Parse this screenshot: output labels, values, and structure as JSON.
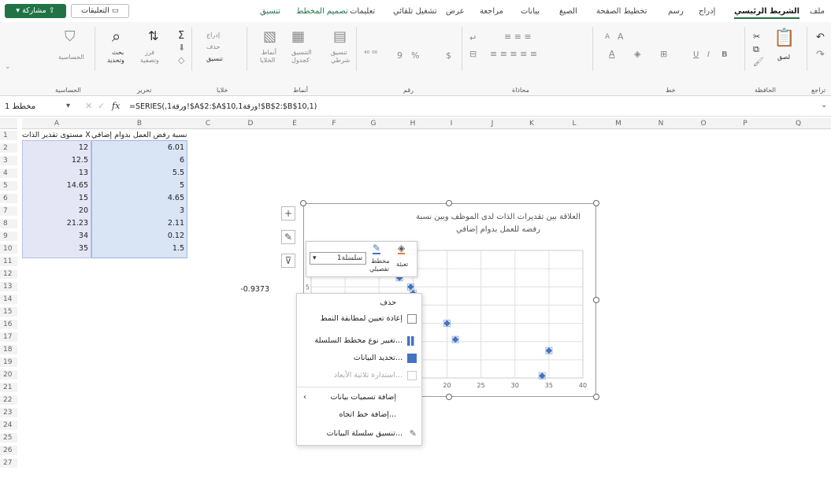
{
  "tabs": {
    "file": "ملف",
    "home": "الشريط الرئيسي",
    "insert": "إدراج",
    "draw": "رسم",
    "page_layout": "تخطيط الصفحة",
    "formulas": "الصيغ",
    "data": "بيانات",
    "review": "مراجعة",
    "view": "عرض",
    "automate": "تشغيل تلقائي",
    "help": "تعليمات",
    "chart_design": "تصميم المخطط",
    "format": "تنسيق"
  },
  "header_buttons": {
    "comments": "التعليقات",
    "share": "مشاركة"
  },
  "ribbon_groups": {
    "undo": "تراجع",
    "clipboard": "الحافظة",
    "font": "خط",
    "alignment": "محاذاة",
    "number": "رقم",
    "styles": "أنماط",
    "cells": "خلايا",
    "editing": "تحرير",
    "sensitivity": "الحساسية"
  },
  "ribbon_items": {
    "paste": "لصق",
    "find": "بحث",
    "find2": "وتحديد",
    "sort": "فرز",
    "filter": "وتصفية",
    "format_cells": "تنسيق",
    "insert_cells": "إدراج",
    "delete_cells": "حذف",
    "cond_format": "تنسيق",
    "cond_format2": "شرطي",
    "format_table": "التنسيق",
    "format_table2": "كجدول",
    "cell_styles": "أنماط",
    "cell_styles2": "الخلايا",
    "sensitivity": "الحساسية",
    "currency": "$",
    "percent": "%",
    "comma": "9",
    "font_size_up": "A",
    "font_size_down": "A",
    "bold": "B",
    "italic": "I",
    "underline": "U"
  },
  "formula_bar": {
    "name_box": "مخطط 1",
    "fx": "fx",
    "formula": "=SERIES(,ورقة1!$A$2:$A$10,ورقة1!$B$2:$B$10,1)"
  },
  "columns": [
    "A",
    "B",
    "C",
    "D",
    "E",
    "F",
    "G",
    "H",
    "I",
    "J",
    "K",
    "L",
    "M",
    "N",
    "O",
    "P",
    "Q"
  ],
  "rows": [
    "1",
    "2",
    "3",
    "4",
    "5",
    "6",
    "7",
    "8",
    "9",
    "10",
    "11",
    "12",
    "13",
    "14",
    "15",
    "16",
    "17",
    "18",
    "19",
    "20",
    "21",
    "22",
    "23",
    "24",
    "25",
    "26",
    "27"
  ],
  "sheet": {
    "header_a": "مستوى تقدير الذات X",
    "header_b": "نسبة رفض العمل بدوام إضافي Y",
    "col_a": [
      "12",
      "12.5",
      "13",
      "14.65",
      "15",
      "20",
      "21.23",
      "34",
      "35"
    ],
    "col_b": [
      "6.01",
      "6",
      "5.5",
      "5",
      "4.65",
      "3",
      "2.11",
      "0.12",
      "1.5"
    ],
    "d13": "-0.9373"
  },
  "chart_data": {
    "type": "scatter",
    "title": "العلاقة بين تقديرات الذات لدى الموظف وبين نسبة رفضه للعمل بدوام إضافي",
    "x": [
      12,
      12.5,
      13,
      14.65,
      15,
      20,
      21.23,
      34,
      35
    ],
    "y": [
      6.01,
      6,
      5.5,
      5,
      4.65,
      3,
      2.11,
      0.12,
      1.5
    ],
    "xticks": [
      "20",
      "25",
      "30",
      "35",
      "40"
    ],
    "yticks": [
      "5"
    ],
    "xlim": [
      0,
      40
    ],
    "ylim": [
      0,
      7
    ],
    "grid": true,
    "marker_color": "#4472c4"
  },
  "mini_toolbar": {
    "series_select": "سلسلة1",
    "fill": "تعبئة",
    "outline": "مخطط",
    "outline2": "تفصيلي"
  },
  "context_menu": {
    "delete": "حذف",
    "reset": "إعادة تعيين لمطابقة النمط",
    "change_type": "تغيير نوع مخطط السلسلة...",
    "select_data": "تحديد البيانات...",
    "rotate_3d": "استدارة ثلاثية الأبعاد...",
    "add_labels": "إضافة تسميات بيانات",
    "add_trendline": "إضافة خط اتجاه...",
    "format_series": "تنسيق سلسلة البيانات..."
  },
  "side_buttons": {
    "plus": "+"
  },
  "colors": {
    "excel_green": "#217346",
    "selection_a": "#e4e6f6",
    "selection_b": "#d9e4f5",
    "marker": "#4472c4"
  }
}
